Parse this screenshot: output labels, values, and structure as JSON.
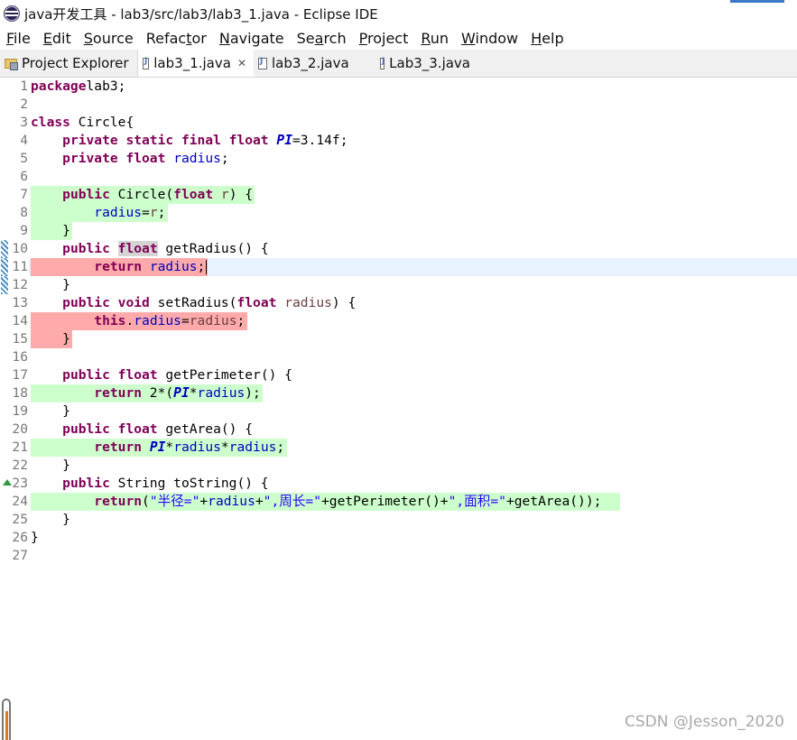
{
  "window": {
    "title": "java开发工具 - lab3/src/lab3/lab3_1.java - Eclipse IDE"
  },
  "menu": [
    {
      "mn": "F",
      "rest": "ile"
    },
    {
      "mn": "E",
      "rest": "dit"
    },
    {
      "mn": "S",
      "rest": "ource"
    },
    {
      "pre": "Refac",
      "mn": "t",
      "rest": "or"
    },
    {
      "mn": "N",
      "rest": "avigate"
    },
    {
      "pre": "Se",
      "mn": "a",
      "rest": "rch"
    },
    {
      "mn": "P",
      "rest": "roject"
    },
    {
      "mn": "R",
      "rest": "un"
    },
    {
      "mn": "W",
      "rest": "indow"
    },
    {
      "mn": "H",
      "rest": "elp"
    }
  ],
  "tabs": {
    "explorer": "Project Explorer",
    "active": "lab3_1.java",
    "close": "✕",
    "second": "lab3_2.java",
    "third": "Lab3_3.java"
  },
  "editor": {
    "lines": [
      {
        "n": "1",
        "hl": null,
        "tokens": [
          [
            "kw",
            "package"
          ],
          [
            "",
            "lab3;"
          ]
        ]
      },
      {
        "n": "2",
        "hl": null,
        "tokens": []
      },
      {
        "n": "3",
        "hl": null,
        "tokens": [
          [
            "kw",
            "class"
          ],
          [
            "",
            " Circle{"
          ]
        ]
      },
      {
        "n": "4",
        "hl": null,
        "tokens": [
          [
            "",
            "    "
          ],
          [
            "kw",
            "private static final float"
          ],
          [
            "",
            " "
          ],
          [
            "sfld",
            "PI"
          ],
          [
            "",
            "=3.14f;"
          ]
        ]
      },
      {
        "n": "5",
        "hl": null,
        "tokens": [
          [
            "",
            "    "
          ],
          [
            "kw",
            "private float"
          ],
          [
            "",
            " "
          ],
          [
            "fld",
            "radius"
          ],
          [
            "",
            ";"
          ]
        ]
      },
      {
        "n": "6",
        "hl": null,
        "tokens": []
      },
      {
        "n": "7",
        "hl": "green",
        "tokens": [
          [
            "",
            "    "
          ],
          [
            "kw",
            "public"
          ],
          [
            "",
            " Circle("
          ],
          [
            "kw",
            "float"
          ],
          [
            "",
            " "
          ],
          [
            "par",
            "r"
          ],
          [
            "",
            ") {"
          ]
        ]
      },
      {
        "n": "8",
        "hl": "green",
        "tokens": [
          [
            "",
            "        "
          ],
          [
            "fld",
            "radius"
          ],
          [
            "",
            "="
          ],
          [
            "par",
            "r"
          ],
          [
            "",
            ";"
          ]
        ]
      },
      {
        "n": "9",
        "hl": "green",
        "tokens": [
          [
            "",
            "    }"
          ]
        ]
      },
      {
        "n": "10",
        "hl": null,
        "mark": "gutter",
        "tokens": [
          [
            "",
            "    "
          ],
          [
            "kw",
            "public"
          ],
          [
            "",
            " "
          ],
          [
            "kwbox",
            "float"
          ],
          [
            "",
            " getRadius() {"
          ]
        ]
      },
      {
        "n": "11",
        "hl": "red",
        "current": true,
        "mark": "gutter",
        "tokens": [
          [
            "",
            "        "
          ],
          [
            "kw",
            "return"
          ],
          [
            "",
            " "
          ],
          [
            "fld",
            "radius"
          ],
          [
            "",
            ";"
          ]
        ]
      },
      {
        "n": "12",
        "hl": null,
        "mark": "gutter",
        "tokens": [
          [
            "",
            "    }"
          ]
        ]
      },
      {
        "n": "13",
        "hl": null,
        "tokens": [
          [
            "",
            "    "
          ],
          [
            "kw",
            "public void"
          ],
          [
            "",
            " setRadius("
          ],
          [
            "kw",
            "float"
          ],
          [
            "",
            " "
          ],
          [
            "par",
            "radius"
          ],
          [
            "",
            ") {"
          ]
        ]
      },
      {
        "n": "14",
        "hl": "red",
        "tokens": [
          [
            "",
            "        "
          ],
          [
            "kw",
            "this"
          ],
          [
            "",
            "."
          ],
          [
            "fld",
            "radius"
          ],
          [
            "",
            "="
          ],
          [
            "par",
            "radius"
          ],
          [
            "",
            ";"
          ]
        ]
      },
      {
        "n": "15",
        "hl": "red",
        "tokens": [
          [
            "",
            "    }"
          ]
        ]
      },
      {
        "n": "16",
        "hl": null,
        "tokens": []
      },
      {
        "n": "17",
        "hl": null,
        "tokens": [
          [
            "",
            "    "
          ],
          [
            "kw",
            "public float"
          ],
          [
            "",
            " getPerimeter() {"
          ]
        ]
      },
      {
        "n": "18",
        "hl": "green",
        "tokens": [
          [
            "",
            "        "
          ],
          [
            "kw",
            "return"
          ],
          [
            "",
            " 2*("
          ],
          [
            "sfld",
            "PI"
          ],
          [
            "",
            "*"
          ],
          [
            "fld",
            "radius"
          ],
          [
            "",
            ");"
          ]
        ]
      },
      {
        "n": "19",
        "hl": null,
        "tokens": [
          [
            "",
            "    }"
          ]
        ]
      },
      {
        "n": "20",
        "hl": null,
        "tokens": [
          [
            "",
            "    "
          ],
          [
            "kw",
            "public float"
          ],
          [
            "",
            " getArea() {"
          ]
        ]
      },
      {
        "n": "21",
        "hl": "green",
        "tokens": [
          [
            "",
            "        "
          ],
          [
            "kw",
            "return"
          ],
          [
            "",
            " "
          ],
          [
            "sfld",
            "PI"
          ],
          [
            "",
            "*"
          ],
          [
            "fld",
            "radius"
          ],
          [
            "",
            "*"
          ],
          [
            "fld",
            "radius"
          ],
          [
            "",
            ";"
          ]
        ]
      },
      {
        "n": "22",
        "hl": null,
        "tokens": [
          [
            "",
            "    }"
          ]
        ]
      },
      {
        "n": "23",
        "hl": null,
        "mark": "override",
        "tokens": [
          [
            "",
            "    "
          ],
          [
            "kw",
            "public"
          ],
          [
            "",
            " String toString() {"
          ]
        ]
      },
      {
        "n": "24",
        "hl": "green",
        "tokens": [
          [
            "",
            "        "
          ],
          [
            "kw",
            "return"
          ],
          [
            "",
            "("
          ],
          [
            "str",
            "\"半径=\""
          ],
          [
            "",
            "+"
          ],
          [
            "fld",
            "radius"
          ],
          [
            "",
            "+"
          ],
          [
            "str",
            "\",周长=\""
          ],
          [
            "",
            "+getPerimeter()+"
          ],
          [
            "str",
            "\",面积=\""
          ],
          [
            "",
            "+getArea());"
          ]
        ]
      },
      {
        "n": "25",
        "hl": null,
        "tokens": [
          [
            "",
            "    }"
          ]
        ]
      },
      {
        "n": "26",
        "hl": null,
        "tokens": [
          [
            "",
            "}"
          ]
        ]
      },
      {
        "n": "27",
        "hl": null,
        "tokens": []
      }
    ]
  },
  "watermark": "CSDN @Jesson_2020",
  "colors": {
    "keyword": "#7f0055",
    "field": "#0000c0",
    "string": "#2a00ff",
    "coverage_green": "#ccffcc",
    "coverage_red": "#ffaaaa",
    "current_line": "#e8f2fe"
  }
}
